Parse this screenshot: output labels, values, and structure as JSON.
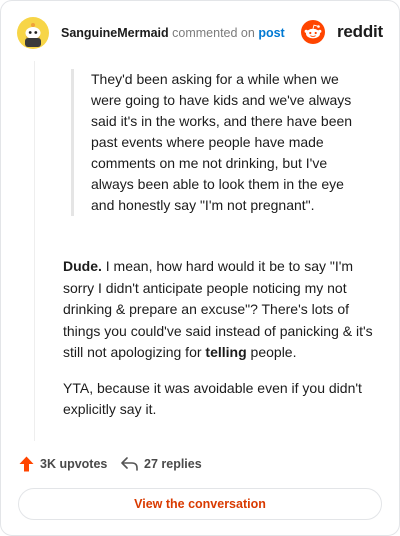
{
  "header": {
    "username": "SanguineMermaid",
    "action_text": "commented on",
    "post_link": "post",
    "brand_wordmark": "reddit"
  },
  "comment": {
    "quote": "They'd been asking for a while when we were going to have kids and we've always said it's in the works, and there have been past events where people have made comments on me not drinking, but I've always been able to look them in the eye and honestly say \"I'm not pregnant\".",
    "p1_bold_lead": "Dude.",
    "p1_text_a": " I mean, how hard would it be to say \"I'm sorry I didn't anticipate people noticing my not drinking & prepare an excuse\"? There's lots of things you could've said instead of panicking & it's still not apologizing for ",
    "p1_bold_word": "telling",
    "p1_text_b": " people.",
    "p2": "YTA, because it was avoidable even if you didn't explicitly say it."
  },
  "footer": {
    "upvotes": "3K upvotes",
    "replies": "27 replies",
    "view_conversation": "View the conversation"
  },
  "colors": {
    "accent_orange": "#ff4500",
    "link_blue": "#0079d3",
    "button_text": "#d93a00",
    "avatar_yellow": "#f7d547"
  },
  "icons": {
    "avatar": "snoo-avatar-icon",
    "brand": "reddit-logo-icon",
    "upvote": "upvote-arrow-icon",
    "reply": "reply-arrow-icon"
  }
}
